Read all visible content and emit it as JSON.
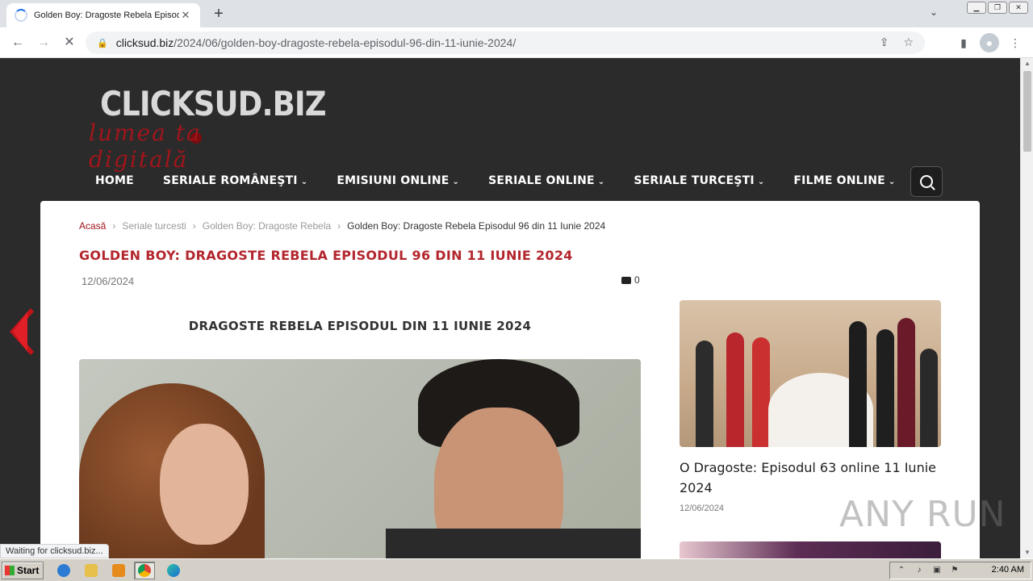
{
  "browser": {
    "tab_title": "Golden Boy: Dragoste Rebela Episod",
    "tab_close": "✕",
    "new_tab": "+",
    "url_host": "clicksud.biz",
    "url_path": "/2024/06/golden-boy-dragoste-rebela-episodul-96-din-11-iunie-2024/",
    "status_text": "Waiting for clicksud.biz..."
  },
  "site": {
    "logo_main": "CLICKSUD.BIZ",
    "logo_tagline": "lumea ta digitală",
    "nav": [
      {
        "label": "HOME",
        "caret": ""
      },
      {
        "label": "SERIALE ROMÂNEŞTI",
        "caret": "⌄"
      },
      {
        "label": "EMISIUNI ONLINE",
        "caret": "⌄"
      },
      {
        "label": "SERIALE ONLINE",
        "caret": "⌄"
      },
      {
        "label": "SERIALE TURCEŞTI",
        "caret": "⌄"
      },
      {
        "label": "FILME ONLINE",
        "caret": "⌄"
      }
    ]
  },
  "breadcrumb": {
    "home": "Acasă",
    "sep": "›",
    "category": "Seriale turcesti",
    "series": "Golden Boy: Dragoste Rebela",
    "current": "Golden Boy: Dragoste Rebela Episodul 96 din 11 Iunie 2024"
  },
  "post": {
    "title": "GOLDEN BOY: DRAGOSTE REBELA EPISODUL 96 DIN 11 IUNIE 2024",
    "date": "12/06/2024",
    "comment_count": "0",
    "subheading": "DRAGOSTE REBELA EPISODUL DIN 11 IUNIE 2024"
  },
  "sidebar": {
    "card1_title": "O Dragoste: Episodul 63 online 11 Iunie 2024",
    "card1_date": "12/06/2024"
  },
  "watermark": "ANY RUN",
  "taskbar": {
    "start_label": "Start",
    "clock": "2:40 AM"
  }
}
